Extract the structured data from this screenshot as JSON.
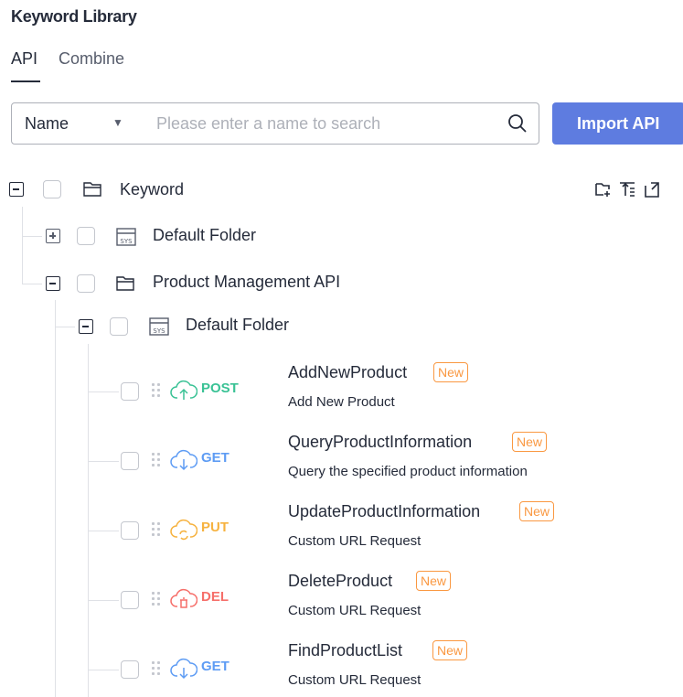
{
  "header": {
    "title": "Keyword Library"
  },
  "tabs": [
    {
      "label": "API"
    },
    {
      "label": "Combine"
    }
  ],
  "search": {
    "field": "Name",
    "placeholder": "Please enter a name to search"
  },
  "import_button": "Import API",
  "tree": {
    "root": "Keyword",
    "default_folder": "Default Folder",
    "product_folder": "Product Management API",
    "sub_folder": "Default Folder"
  },
  "apis": [
    {
      "method": "POST",
      "name": "AddNewProduct",
      "badge": "New",
      "desc": "Add New Product",
      "color": "#3ac295"
    },
    {
      "method": "GET",
      "name": "QueryProductInformation",
      "badge": "New",
      "desc": "Query the specified product information",
      "color": "#5e9cf4"
    },
    {
      "method": "PUT",
      "name": "UpdateProductInformation",
      "badge": "New",
      "desc": "Custom URL Request",
      "color": "#f6b23f"
    },
    {
      "method": "DEL",
      "name": "DeleteProduct",
      "badge": "New",
      "desc": "Custom URL Request",
      "color": "#f66f6a"
    },
    {
      "method": "GET",
      "name": "FindProductList",
      "badge": "New",
      "desc": "Custom URL Request",
      "color": "#5e9cf4"
    }
  ]
}
